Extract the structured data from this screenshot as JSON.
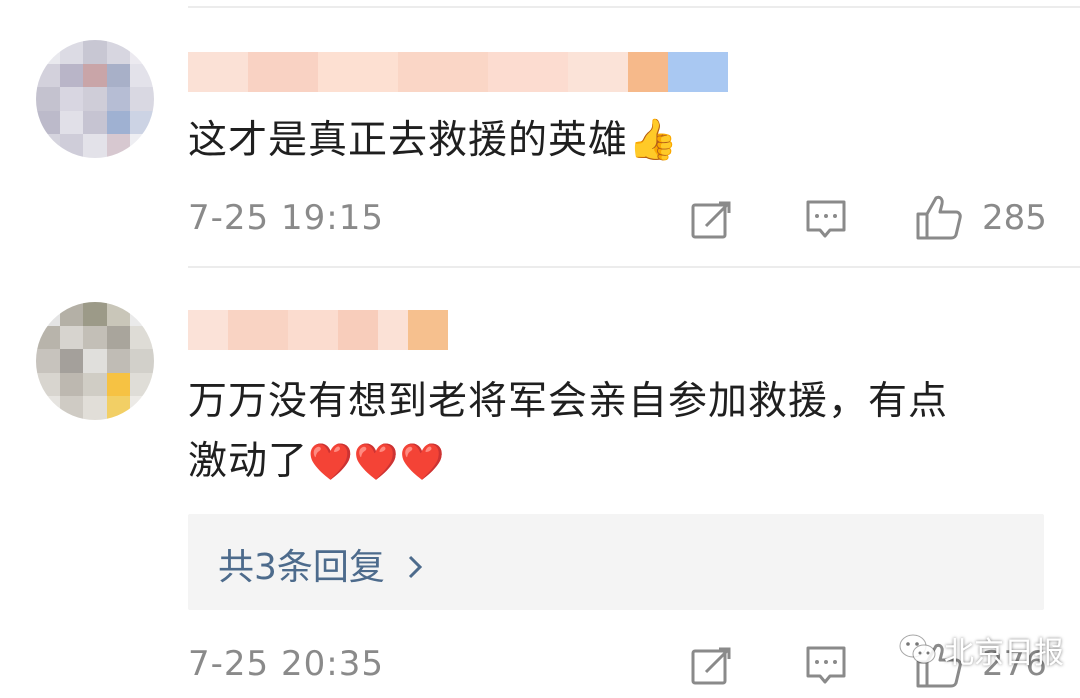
{
  "comments": [
    {
      "text": "这才是真正去救援的英雄",
      "emoji": "👍",
      "time": "7-25 19:15",
      "likes": "285"
    },
    {
      "text_line1": "万万没有想到老将军会亲自参加救援，有点",
      "text_line2": "激动了",
      "emoji": "❤️❤️❤️",
      "time": "7-25 20:35",
      "likes": "276",
      "replies_label": "共3条回复"
    }
  ],
  "watermark": "北京日报",
  "colors": {
    "meta": "#8a8a8a",
    "reply_link": "#4d6b8c",
    "reply_bg": "#f4f4f4"
  },
  "icons": [
    "share-icon",
    "comment-icon",
    "like-icon",
    "chevron-right-icon",
    "wechat-icon"
  ]
}
